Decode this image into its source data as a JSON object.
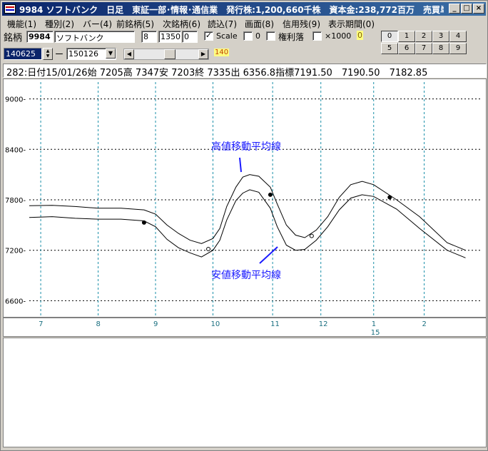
{
  "window": {
    "title": "9984 ソフトバンク　日足　東証一部･情報･通信業　発行株:1,200,660千株　資本金:238,772百万　売買単...",
    "controls": [
      "_",
      "□",
      "×"
    ]
  },
  "menu": [
    "機能(1)",
    "種別(2)",
    "バー(4)",
    "前銘柄(5)",
    "次銘柄(6)",
    "読込(7)",
    "画面(8)",
    "信用残(9)",
    "表示期間(0)"
  ],
  "toolbar": {
    "ticker_label": "銘柄",
    "ticker_code": "9984",
    "ticker_name": "ソフトバンク",
    "field_a": "8",
    "field_b": "1350",
    "field_c": "0",
    "scale_checked": "✓",
    "scale_label": "Scale",
    "check_zero_label": "0",
    "rights_label": "権利落",
    "times_label": "×1000",
    "badge": "0",
    "number_buttons": [
      "0",
      "1",
      "2",
      "3",
      "4",
      "5",
      "6",
      "7",
      "8",
      "9"
    ],
    "start_date": "140625",
    "end_date": "150126",
    "dash": "ー",
    "scroll_value": "140"
  },
  "info": {
    "text": "282:日付15/01/26始 7205高 7347安 7203終 7335出 6356.8指標7191.50　7190.50　7182.85"
  },
  "chart_data": {
    "type": "line",
    "ylim": [
      6400,
      9200
    ],
    "y_ticks": [
      6600,
      7200,
      7800,
      8400,
      9000
    ],
    "x_tick_labels": [
      "7",
      "8",
      "9",
      "10",
      "11",
      "12",
      "1",
      "2"
    ],
    "year_label": "15",
    "annotations": {
      "high_label": "高値移動平均線",
      "low_label": "安値移動平均線"
    },
    "colors": {
      "annotation": "#1a1aff",
      "line": "#000000",
      "vgrid": "#1a8fa8",
      "hgrid": "#000000"
    },
    "series": [
      {
        "x": [
          0,
          10,
          20,
          30,
          40,
          50,
          55,
          60,
          65,
          70,
          75,
          80,
          83,
          86,
          90,
          93,
          96,
          100,
          105,
          108,
          112,
          116,
          120,
          125,
          130,
          135,
          140,
          145,
          150,
          160,
          170,
          182,
          190
        ],
        "y": [
          7730,
          7735,
          7720,
          7700,
          7700,
          7680,
          7630,
          7500,
          7400,
          7320,
          7280,
          7340,
          7460,
          7720,
          7950,
          8070,
          8100,
          8080,
          7950,
          7750,
          7500,
          7380,
          7350,
          7440,
          7600,
          7830,
          7980,
          8020,
          7980,
          7800,
          7600,
          7290,
          7200
        ]
      },
      {
        "x": [
          0,
          10,
          20,
          30,
          40,
          50,
          55,
          60,
          65,
          70,
          75,
          80,
          83,
          86,
          90,
          93,
          96,
          100,
          105,
          108,
          112,
          116,
          120,
          125,
          130,
          135,
          140,
          145,
          150,
          160,
          170,
          182,
          190
        ],
        "y": [
          7590,
          7600,
          7580,
          7570,
          7570,
          7550,
          7480,
          7330,
          7230,
          7170,
          7120,
          7200,
          7320,
          7560,
          7790,
          7880,
          7920,
          7890,
          7700,
          7480,
          7260,
          7200,
          7210,
          7320,
          7480,
          7680,
          7820,
          7860,
          7840,
          7690,
          7460,
          7200,
          7110
        ]
      }
    ],
    "markers": [
      {
        "series": 0,
        "x": 50,
        "y": 7530,
        "style": "filled"
      },
      {
        "series": 1,
        "x": 78,
        "y": 7215,
        "style": "open"
      },
      {
        "series": 0,
        "x": 105,
        "y": 7860,
        "style": "filled"
      },
      {
        "series": 1,
        "x": 123,
        "y": 7370,
        "style": "open"
      },
      {
        "series": 0,
        "x": 157,
        "y": 7830,
        "style": "filled"
      }
    ]
  }
}
